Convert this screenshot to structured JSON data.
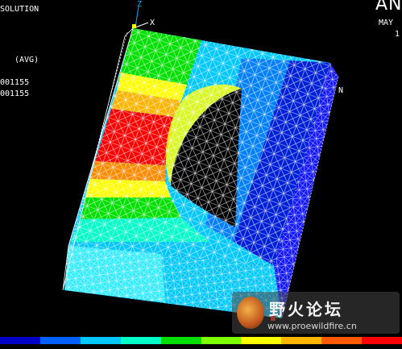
{
  "header": {
    "solution_label": "SOLUTION",
    "avg_label": "(AVG)",
    "value_line_1": "001155",
    "value_line_2": "001155",
    "brand": "AN",
    "month": "MAY",
    "day": "1"
  },
  "axes": {
    "z": "Z",
    "x": "X"
  },
  "node_label": "N",
  "legend": {
    "colors": [
      "#0000c8",
      "#0060ff",
      "#00c8ff",
      "#00ffc8",
      "#00e000",
      "#7cff00",
      "#ffff00",
      "#ffb400",
      "#ff5a00",
      "#ff0000"
    ],
    "tick_labels": [
      "",
      "",
      "",
      "",
      "",
      ""
    ]
  },
  "watermark": {
    "text": "野火论坛",
    "url": "www.proewildfire.cn"
  }
}
